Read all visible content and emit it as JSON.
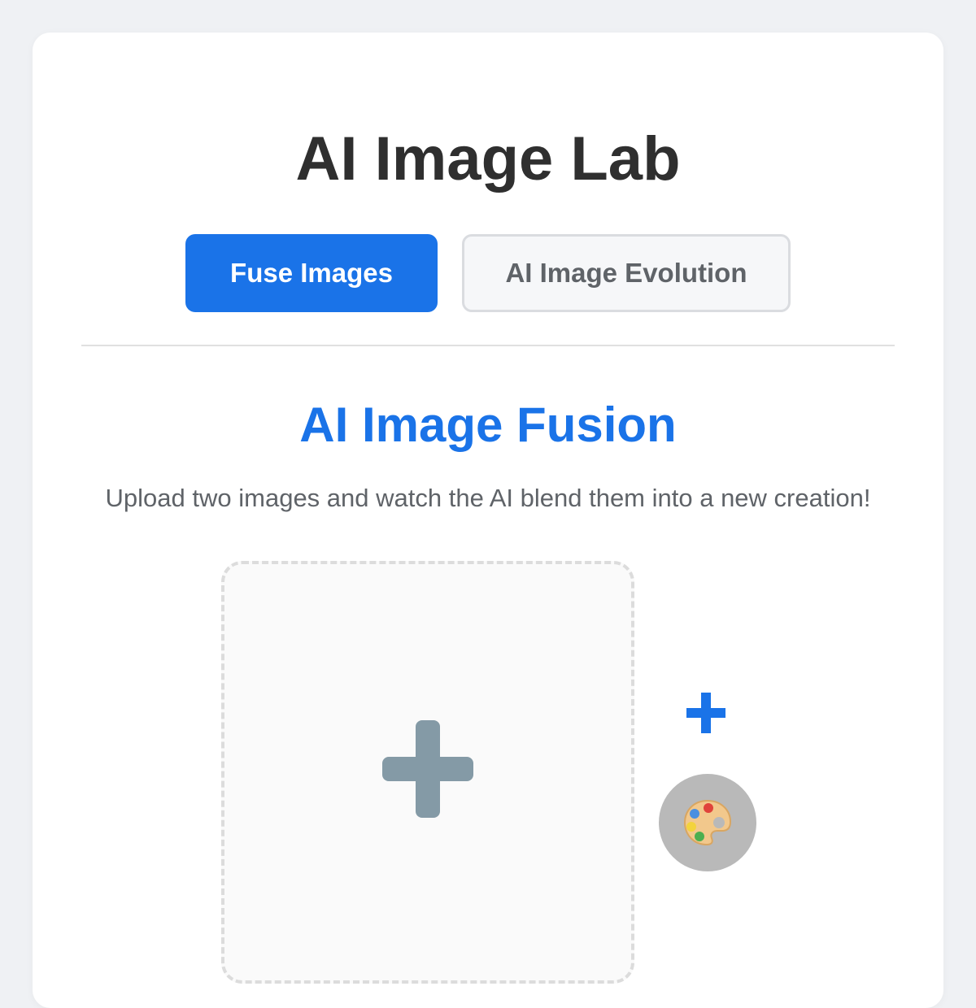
{
  "app": {
    "title": "AI Image Lab"
  },
  "tabs": [
    {
      "label": "Fuse Images",
      "active": true
    },
    {
      "label": "AI Image Evolution",
      "active": false
    }
  ],
  "fusion": {
    "title": "AI Image Fusion",
    "description": "Upload two images and watch the AI blend them into a new creation!",
    "upload_icon": "plus-icon",
    "join_icon": "plus-icon",
    "result_icon": "palette-icon"
  },
  "colors": {
    "accent": "#1a73e8",
    "background": "#eff1f4",
    "card": "#ffffff",
    "plus_gray": "#849aa6"
  }
}
